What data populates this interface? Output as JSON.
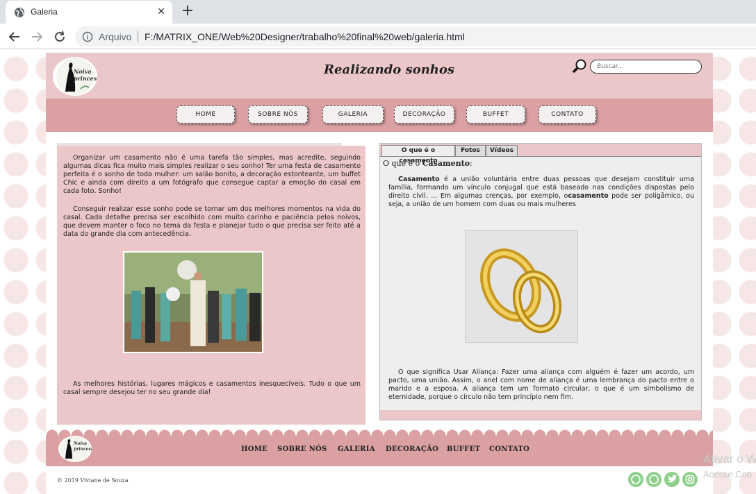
{
  "browser": {
    "tab_title": "Galeria",
    "tab_close": "✕",
    "new_tab": "+",
    "address_label": "Arquivo",
    "url": "F:/MATRIX_ONE/Web%20Designer/trabalho%20final%20web/galeria.html"
  },
  "header": {
    "logo_text": "Noiva princesa",
    "title": "Realizando sonhos",
    "search_placeholder": "Buscar..."
  },
  "nav": [
    "HOME",
    "SOBRE NÓS",
    "GALERIA",
    "DECORAÇÃO",
    "BUFFET",
    "CONTATO"
  ],
  "left": {
    "para1": "Organizar um casamento não é uma tarefa tão simples, mas acredite, seguindo algumas dicas fica muito mais simples realizar o seu sonho! Ter uma festa de casamento perfeita é o sonho de toda mulher: um salão bonito, a decoração estonteante, um buffet Chic e ainda com direito a um fotógrafo que consegue captar a emoção do casal em cada foto. Sonho!",
    "para2": "Conseguir realizar esse sonho pode se tornar um dos melhores momentos na vida do casal. Cada detalhe precisa ser escolhido com muito carinho e paciência pelos noivos, que devem manter o foco no tema da festa e planejar tudo o que precisa ser feito até a data do grande dia com antecedência.",
    "para3": "As melhores histórias, lugares mágicos e casamentos inesquecíveis. Tudo o que um casal sempre desejou ter no seu grande dia!"
  },
  "tabs": [
    "O que é o casamento",
    "Fotos",
    "Vídeos"
  ],
  "tab_content": {
    "heading_prefix": "O que é o ",
    "heading_bold": "Casamento",
    "heading_suffix": ":",
    "p1_bold1": "Casamento",
    "p1_text1": " é a união voluntária entre duas pessoas que desejam constituir uma família, formando um vínculo conjugal que está baseado nas condições dispostas pelo direito civil. ... Em algumas crenças, por exemplo, o",
    "p1_bold2": "casamento",
    "p1_text2": " pode ser poligâmico, ou seja, a união de um homem com duas ou mais mulheres",
    "p2": "O que significa Usar Aliança: Fazer uma aliança com alguém é fazer um acordo, um pacto, uma união. Assim, o anel com nome de aliança é uma lembrança do pacto entre o marido e a esposa. A aliança tem um formato circular, o que é um simbolismo de eternidade, porque o círculo não tem princípio nem fim."
  },
  "footer": {
    "logo_text": "Noiva princesa",
    "links": [
      "HOME",
      "SOBRE NÓS",
      "GALERIA",
      "DECORAÇÃO",
      "BUFFET",
      "CONTATO"
    ],
    "copyright": "© 2019 Viviane de Souza",
    "social_icons": [
      "whatsapp-icon",
      "whatsapp-icon",
      "twitter-icon",
      "instagram-icon"
    ]
  },
  "watermark": {
    "line1": "Ativar o W",
    "line2": "Acesse Con"
  },
  "colors": {
    "header_bg": "#ecc7ca",
    "nav_bg": "#dba0a2",
    "social_green": "#8fd08e"
  }
}
